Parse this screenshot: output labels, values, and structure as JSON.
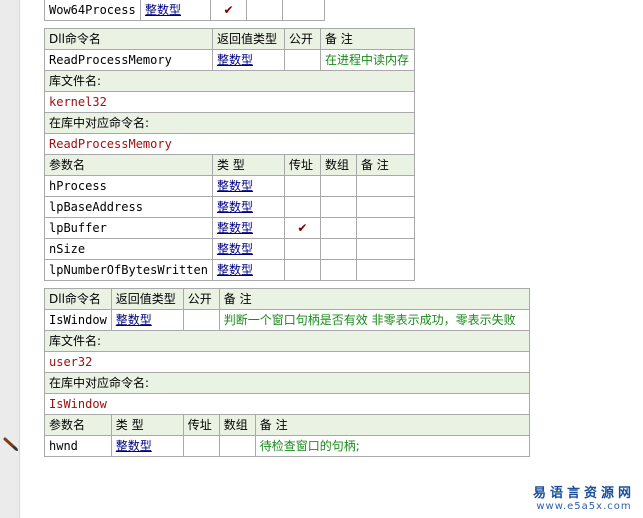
{
  "top_row": {
    "name": "Wow64Process",
    "type": "整数型",
    "checkmark": "✔"
  },
  "rpm": {
    "headers": [
      "Dll命令名",
      "返回值类型",
      "公开",
      "备 注"
    ],
    "name": "ReadProcessMemory",
    "return_type": "整数型",
    "remark": "在进程中读内存",
    "lib_label": "库文件名:",
    "lib_value": "kernel32",
    "cmd_label": "在库中对应命令名:",
    "cmd_value": "ReadProcessMemory",
    "param_headers": [
      "参数名",
      "类 型",
      "传址",
      "数组",
      "备 注"
    ],
    "params": [
      {
        "name": "hProcess",
        "type": "整数型",
        "by_ref": ""
      },
      {
        "name": "lpBaseAddress",
        "type": "整数型",
        "by_ref": ""
      },
      {
        "name": "lpBuffer",
        "type": "整数型",
        "by_ref": "✔"
      },
      {
        "name": "nSize",
        "type": "整数型",
        "by_ref": ""
      },
      {
        "name": "lpNumberOfBytesWritten",
        "type": "整数型",
        "by_ref": ""
      }
    ]
  },
  "isw": {
    "headers": [
      "Dll命令名",
      "返回值类型",
      "公开",
      "备 注"
    ],
    "name": "IsWindow",
    "return_type": "整数型",
    "remark": "判断一个窗口句柄是否有效  非零表示成功，零表示失败",
    "lib_label": "库文件名:",
    "lib_value": "user32",
    "cmd_label": "在库中对应命令名:",
    "cmd_value": "IsWindow",
    "param_headers": [
      "参数名",
      "类 型",
      "传址",
      "数组",
      "备 注"
    ],
    "params": [
      {
        "name": "hwnd",
        "type": "整数型",
        "remark": "待检查窗口的句柄;"
      }
    ]
  },
  "watermark": {
    "cn": "易语言资源网",
    "en": "www.e5a5x.com"
  },
  "colors": {
    "header_bg": "#eaf2e4",
    "type_link": "#000080",
    "remark_green": "#1a8a1a",
    "lib_red": "#a01010"
  }
}
